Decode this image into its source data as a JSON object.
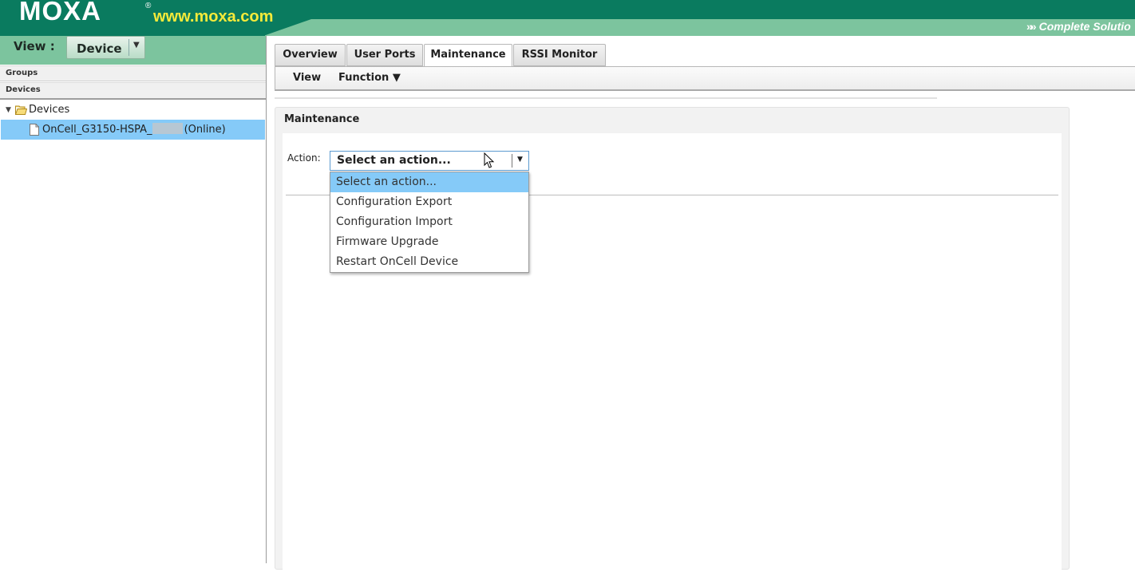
{
  "header": {
    "logo": "MOXA",
    "logo_mark": "®",
    "url": "www.moxa.com",
    "slogan_arrows": "»»",
    "slogan": "Complete Solutio"
  },
  "left": {
    "view_label": "View :",
    "view_value": "Device",
    "view_arrow": "▼",
    "groups_label": "Groups",
    "devices_label": "Devices",
    "tree": {
      "root_toggle": "▼",
      "root_label": "Devices",
      "device_name": "OnCell_G3150-HSPA_",
      "device_status": "(Online)"
    }
  },
  "tabs": [
    {
      "label": "Overview"
    },
    {
      "label": "User Ports"
    },
    {
      "label": "Maintenance"
    },
    {
      "label": "RSSI Monitor"
    }
  ],
  "toolbar": {
    "view_label": "View",
    "function_label": "Function ▼"
  },
  "maintenance": {
    "title": "Maintenance",
    "action_label": "Action:",
    "action_value": "Select an action...",
    "action_arrow": "▼",
    "options": [
      "Select an action...",
      "Configuration Export",
      "Configuration Import",
      "Firmware Upgrade",
      "Restart OnCell Device"
    ]
  },
  "colors": {
    "header_dark": "#0a7b5f",
    "header_light": "#7cc49e",
    "url_yellow": "#f4ea3a",
    "selection_blue": "#85caf8"
  }
}
